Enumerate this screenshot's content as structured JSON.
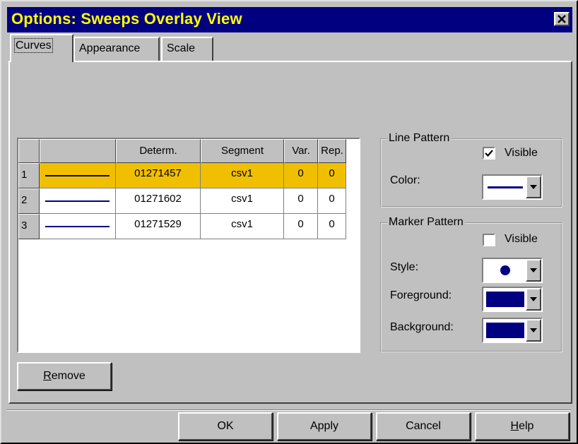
{
  "window": {
    "title": "Options: Sweeps Overlay View",
    "close_glyph": "✕"
  },
  "tabs": [
    {
      "label": "Curves",
      "active": true
    },
    {
      "label": "Appearance",
      "active": false
    },
    {
      "label": "Scale",
      "active": false
    }
  ],
  "grid": {
    "columns": [
      "",
      "Determ.",
      "Segment",
      "Var.",
      "Rep."
    ],
    "rows": [
      {
        "index": "1",
        "determ": "01271457",
        "segment": "csv1",
        "var": "0",
        "rep": "0",
        "selected": true
      },
      {
        "index": "2",
        "determ": "01271602",
        "segment": "csv1",
        "var": "0",
        "rep": "0",
        "selected": false
      },
      {
        "index": "3",
        "determ": "01271529",
        "segment": "csv1",
        "var": "0",
        "rep": "0",
        "selected": false
      }
    ],
    "curve_color": "#000080",
    "selected_color": "#f0c000"
  },
  "line_pattern": {
    "legend": "Line Pattern",
    "visible_label": "Visible",
    "visible_checked": true,
    "color_label": "Color:",
    "color_value": "#000080"
  },
  "marker_pattern": {
    "legend": "Marker Pattern",
    "visible_label": "Visible",
    "visible_checked": false,
    "style_label": "Style:",
    "style_value": "circle",
    "foreground_label": "Foreground:",
    "foreground_value": "#000080",
    "background_label": "Background:",
    "background_value": "#000080"
  },
  "buttons": {
    "remove": "Remove",
    "ok": "OK",
    "apply": "Apply",
    "cancel": "Cancel",
    "help": "Help"
  }
}
